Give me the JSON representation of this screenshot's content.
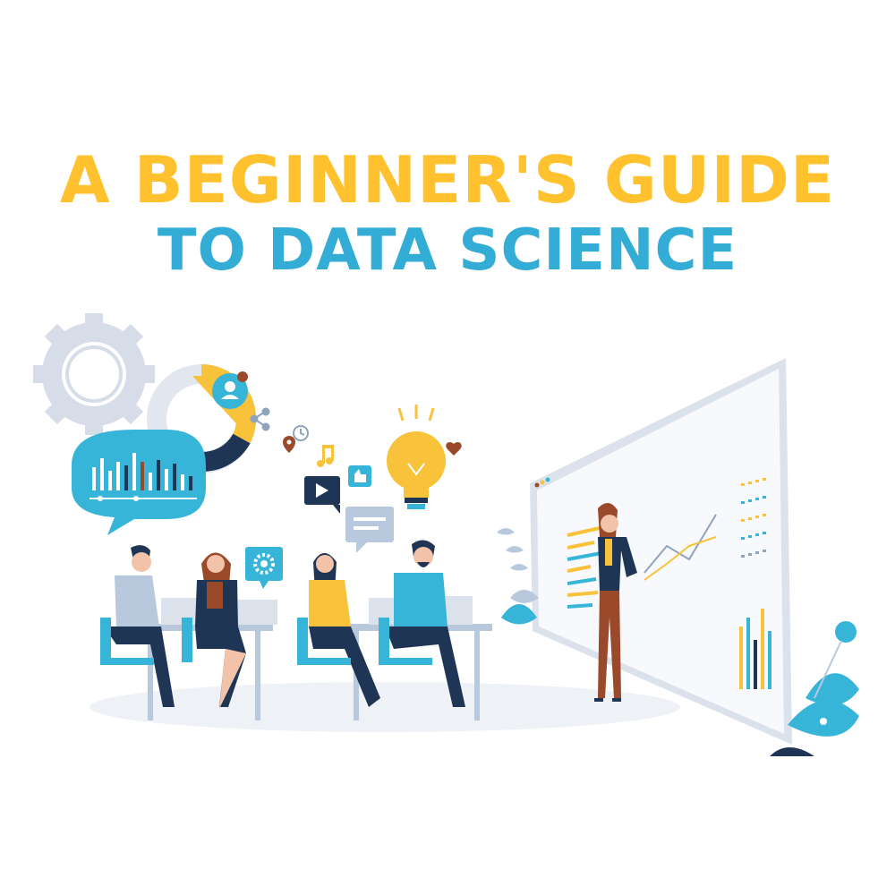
{
  "title": {
    "line1": "A BEGINNER'S GUIDE",
    "line2": "TO DATA SCIENCE"
  },
  "colors": {
    "title_line1": "#FFC22E",
    "title_line2": "#33ADD5",
    "accent_teal": "#37B5D9",
    "accent_yellow": "#F8C23A",
    "navy": "#1F3556",
    "gear_gray": "#D7DDE8",
    "rust": "#9A4A2A"
  },
  "icons": [
    "gear-icon",
    "donut-chart-icon",
    "user-profile-icon",
    "share-icon",
    "clock-icon",
    "location-pin-icon",
    "music-note-icon",
    "like-icon",
    "play-icon",
    "lightbulb-icon",
    "heart-icon",
    "chat-bubble-icon",
    "settings-icon",
    "bar-chart-bubble-icon",
    "plant-icon"
  ]
}
